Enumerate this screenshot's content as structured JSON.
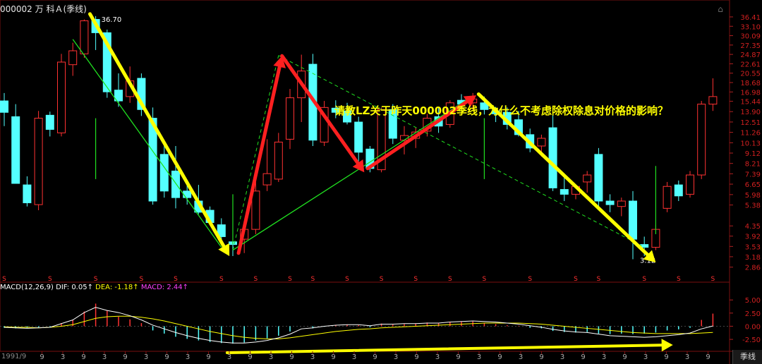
{
  "header": {
    "code_name": "000002 万 科Ａ",
    "period": "(季线)"
  },
  "question": "请教LZ关于昨天000002季线，为什么不考虑除权除息对价格的影响？",
  "macd_label": {
    "name": "MACD(12,26,9)",
    "dif_label": "DIF: 0.05↑",
    "dea_label": "DEA: -1.18↑",
    "macd_value_label": "MACD: 2.44↑"
  },
  "period_button": "季线",
  "bottom_date": "1991/9",
  "colors": {
    "up": "#ff3232",
    "down": "#54ffff",
    "yellow": "#ffff00",
    "red_arrow": "#ff2020",
    "green_line": "#20e020",
    "dif": "#ffffff",
    "dea": "#ffff00",
    "macd_label": "#ff40ff"
  },
  "chart_data": {
    "type": "candlestick",
    "price_axis_ticks": [
      "36.41",
      "33.10",
      "30.09",
      "27.35",
      "24.87",
      "22.61",
      "20.55",
      "18.68",
      "16.98",
      "15.44",
      "13.90",
      "12.51",
      "11.26",
      "10.13",
      "9.12",
      "8.21",
      "7.39",
      "6.65",
      "5.98",
      "5.38",
      "4.35",
      "3.92",
      "3.53",
      "3.18",
      "2.86"
    ],
    "price_min": 2.6,
    "price_max": 38,
    "high_label": "36.70",
    "low_label": "3.12",
    "candles": [
      {
        "o": 15.5,
        "h": 16.8,
        "l": 12.0,
        "c": 13.8
      },
      {
        "o": 13.2,
        "h": 15.0,
        "l": 7.6,
        "c": 6.7
      },
      {
        "o": 6.6,
        "h": 7.2,
        "l": 5.3,
        "c": 5.5
      },
      {
        "o": 5.4,
        "h": 14.0,
        "l": 5.1,
        "c": 13.0
      },
      {
        "o": 13.4,
        "h": 13.9,
        "l": 10.8,
        "c": 11.6
      },
      {
        "o": 11.2,
        "h": 25.0,
        "l": 10.8,
        "c": 23.0
      },
      {
        "o": 22.4,
        "h": 28.0,
        "l": 20.0,
        "c": 25.8
      },
      {
        "o": 25.0,
        "h": 35.5,
        "l": 24.0,
        "c": 35.0
      },
      {
        "o": 35.5,
        "h": 36.7,
        "l": 26.0,
        "c": 31.0
      },
      {
        "o": 31.0,
        "h": 32.0,
        "l": 16.0,
        "c": 17.0
      },
      {
        "o": 17.3,
        "h": 20.5,
        "l": 14.6,
        "c": 15.5
      },
      {
        "o": 16.2,
        "h": 22.0,
        "l": 15.2,
        "c": 19.0
      },
      {
        "o": 19.5,
        "h": 20.5,
        "l": 13.3,
        "c": 14.2
      },
      {
        "o": 13.0,
        "h": 14.5,
        "l": 5.4,
        "c": 5.6
      },
      {
        "o": 9.0,
        "h": 10.4,
        "l": 5.8,
        "c": 6.2
      },
      {
        "o": 7.6,
        "h": 9.8,
        "l": 5.2,
        "c": 5.8
      },
      {
        "o": 6.2,
        "h": 6.8,
        "l": 5.4,
        "c": 5.8
      },
      {
        "o": 5.6,
        "h": 6.6,
        "l": 4.9,
        "c": 5.0
      },
      {
        "o": 5.1,
        "h": 5.3,
        "l": 4.4,
        "c": 4.5
      },
      {
        "o": 4.4,
        "h": 4.7,
        "l": 3.7,
        "c": 3.9
      },
      {
        "o": 3.7,
        "h": 4.4,
        "l": 3.2,
        "c": 3.6
      },
      {
        "o": 3.8,
        "h": 4.5,
        "l": 3.3,
        "c": 4.2
      },
      {
        "o": 4.2,
        "h": 7.5,
        "l": 4.0,
        "c": 6.2
      },
      {
        "o": 6.6,
        "h": 10.5,
        "l": 6.2,
        "c": 7.4
      },
      {
        "o": 7.0,
        "h": 11.2,
        "l": 6.8,
        "c": 10.2
      },
      {
        "o": 10.5,
        "h": 17.5,
        "l": 9.5,
        "c": 16.0
      },
      {
        "o": 16.0,
        "h": 24.8,
        "l": 12.5,
        "c": 21.0
      },
      {
        "o": 22.5,
        "h": 25.0,
        "l": 9.8,
        "c": 10.4
      },
      {
        "o": 10.2,
        "h": 15.5,
        "l": 9.8,
        "c": 14.5
      },
      {
        "o": 14.4,
        "h": 15.6,
        "l": 13.0,
        "c": 13.8
      },
      {
        "o": 14.0,
        "h": 15.2,
        "l": 12.2,
        "c": 12.5
      },
      {
        "o": 12.5,
        "h": 13.2,
        "l": 8.4,
        "c": 9.2
      },
      {
        "o": 9.5,
        "h": 9.8,
        "l": 7.5,
        "c": 7.8
      },
      {
        "o": 7.7,
        "h": 14.5,
        "l": 7.5,
        "c": 14.2
      },
      {
        "o": 14.2,
        "h": 15.0,
        "l": 10.0,
        "c": 10.6
      },
      {
        "o": 10.4,
        "h": 12.0,
        "l": 9.0,
        "c": 10.9
      },
      {
        "o": 10.6,
        "h": 11.8,
        "l": 9.6,
        "c": 11.3
      },
      {
        "o": 11.4,
        "h": 13.6,
        "l": 10.8,
        "c": 13.0
      },
      {
        "o": 13.2,
        "h": 14.6,
        "l": 11.2,
        "c": 12.0
      },
      {
        "o": 12.2,
        "h": 15.6,
        "l": 11.8,
        "c": 15.2
      },
      {
        "o": 15.6,
        "h": 16.6,
        "l": 14.5,
        "c": 15.0
      },
      {
        "o": 15.2,
        "h": 16.8,
        "l": 14.2,
        "c": 15.8
      },
      {
        "o": 15.2,
        "h": 16.2,
        "l": 13.5,
        "c": 14.2
      },
      {
        "o": 14.0,
        "h": 14.6,
        "l": 12.5,
        "c": 13.6
      },
      {
        "o": 13.8,
        "h": 14.5,
        "l": 11.6,
        "c": 12.2
      },
      {
        "o": 12.8,
        "h": 14.0,
        "l": 10.8,
        "c": 11.0
      },
      {
        "o": 11.0,
        "h": 11.7,
        "l": 9.2,
        "c": 9.6
      },
      {
        "o": 9.8,
        "h": 11.0,
        "l": 8.8,
        "c": 10.6
      },
      {
        "o": 11.8,
        "h": 14.5,
        "l": 6.2,
        "c": 6.4
      },
      {
        "o": 6.3,
        "h": 7.2,
        "l": 5.6,
        "c": 6.0
      },
      {
        "o": 6.0,
        "h": 6.6,
        "l": 5.7,
        "c": 6.5
      },
      {
        "o": 6.8,
        "h": 7.6,
        "l": 6.1,
        "c": 7.3
      },
      {
        "o": 9.0,
        "h": 9.6,
        "l": 5.2,
        "c": 5.6
      },
      {
        "o": 5.6,
        "h": 6.0,
        "l": 5.0,
        "c": 5.4
      },
      {
        "o": 5.3,
        "h": 5.8,
        "l": 4.8,
        "c": 5.6
      },
      {
        "o": 5.6,
        "h": 6.2,
        "l": 3.1,
        "c": 3.8
      },
      {
        "o": 3.6,
        "h": 3.9,
        "l": 3.2,
        "c": 3.5
      },
      {
        "o": 3.5,
        "h": 4.4,
        "l": 3.4,
        "c": 4.2
      },
      {
        "o": 5.2,
        "h": 6.8,
        "l": 5.0,
        "c": 6.5
      },
      {
        "o": 6.6,
        "h": 6.9,
        "l": 5.6,
        "c": 5.9
      },
      {
        "o": 6.0,
        "h": 7.6,
        "l": 5.8,
        "c": 7.3
      },
      {
        "o": 7.3,
        "h": 15.5,
        "l": 7.0,
        "c": 15.0
      },
      {
        "o": 15.0,
        "h": 19.5,
        "l": 14.0,
        "c": 16.2
      }
    ],
    "dividend_marks": [
      0,
      4,
      8,
      12,
      15,
      19,
      22,
      25,
      27,
      30,
      33,
      36,
      39,
      42,
      46,
      50,
      52,
      56,
      59,
      62
    ],
    "x_tick_labels": [
      "1991/9",
      "9",
      "3",
      "9",
      "3",
      "9",
      "3",
      "9",
      "3",
      "9",
      "3",
      "9",
      "3",
      "9",
      "3",
      "9",
      "3",
      "9",
      "3",
      "9",
      "3",
      "9",
      "3",
      "9",
      "3",
      "9",
      "3",
      "9",
      "3",
      "9",
      "3",
      "9",
      "3",
      "9",
      "3",
      "9"
    ],
    "macd_axis_ticks": [
      "5.00",
      "2.50",
      "0.00",
      "-2.50"
    ],
    "macd_min": -4.5,
    "macd_max": 6.5,
    "macd_hist": [
      -0.3,
      -0.4,
      -0.3,
      -0.2,
      -0.1,
      0.6,
      1.2,
      2.8,
      4.3,
      3.0,
      1.8,
      1.3,
      0.6,
      -0.8,
      -1.4,
      -2.0,
      -2.4,
      -2.7,
      -3.0,
      -3.2,
      -3.3,
      -3.1,
      -2.7,
      -2.3,
      -1.8,
      -1.0,
      0.0,
      -0.4,
      -0.1,
      0.2,
      0.3,
      0.2,
      -0.2,
      0.5,
      0.3,
      0.4,
      0.5,
      0.7,
      0.6,
      0.8,
      0.9,
      0.9,
      0.6,
      0.4,
      0.2,
      0.1,
      -0.3,
      -0.4,
      -0.9,
      -1.1,
      -1.2,
      -1.1,
      -1.4,
      -1.5,
      -1.4,
      -1.5,
      -1.4,
      -1.2,
      -0.8,
      -0.6,
      -0.3,
      1.2,
      2.4
    ],
    "dif": [
      -0.2,
      -0.3,
      -0.4,
      -0.3,
      -0.2,
      0.5,
      1.2,
      2.6,
      3.6,
      3.0,
      2.6,
      2.0,
      1.2,
      0.2,
      -0.5,
      -1.2,
      -1.8,
      -2.3,
      -2.7,
      -3.0,
      -3.2,
      -3.2,
      -3.0,
      -2.7,
      -2.2,
      -1.5,
      -0.5,
      -0.3,
      0.0,
      0.2,
      0.3,
      0.3,
      0.1,
      0.4,
      0.4,
      0.5,
      0.5,
      0.6,
      0.6,
      0.8,
      0.9,
      1.0,
      0.9,
      0.8,
      0.6,
      0.4,
      0.1,
      -0.2,
      -0.6,
      -0.9,
      -1.1,
      -1.2,
      -1.5,
      -1.8,
      -1.9,
      -2.0,
      -2.1,
      -2.0,
      -1.8,
      -1.6,
      -1.3,
      -0.5,
      0.05
    ],
    "dea": [
      -0.1,
      -0.2,
      -0.2,
      -0.3,
      -0.2,
      0.0,
      0.3,
      0.9,
      1.5,
      1.8,
      1.9,
      1.9,
      1.7,
      1.4,
      1.0,
      0.5,
      0.0,
      -0.5,
      -1.0,
      -1.4,
      -1.8,
      -2.1,
      -2.3,
      -2.4,
      -2.4,
      -2.2,
      -1.9,
      -1.6,
      -1.3,
      -1.0,
      -0.8,
      -0.6,
      -0.5,
      -0.3,
      -0.2,
      -0.1,
      0.0,
      0.1,
      0.2,
      0.3,
      0.4,
      0.5,
      0.6,
      0.6,
      0.6,
      0.6,
      0.5,
      0.4,
      0.2,
      0.0,
      -0.2,
      -0.4,
      -0.6,
      -0.8,
      -1.0,
      -1.2,
      -1.3,
      -1.4,
      -1.4,
      -1.4,
      -1.4,
      -1.3,
      -1.18
    ]
  }
}
